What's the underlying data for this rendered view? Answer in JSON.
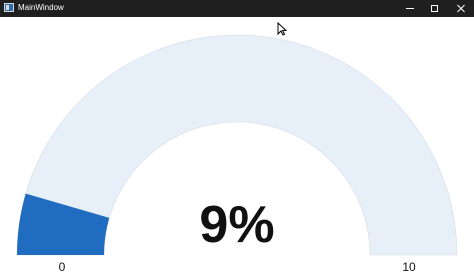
{
  "window": {
    "title": "MainWindow",
    "controls": {
      "minimize_icon": "minimize-icon",
      "maximize_icon": "maximize-icon",
      "close_icon": "close-icon"
    }
  },
  "gauge": {
    "value": 0.9,
    "min": 0,
    "max": 10,
    "value_text": "9%",
    "min_label": "0",
    "max_label": "10",
    "fill_color": "#1f6cc0",
    "track_color": "#e7eff8"
  }
}
